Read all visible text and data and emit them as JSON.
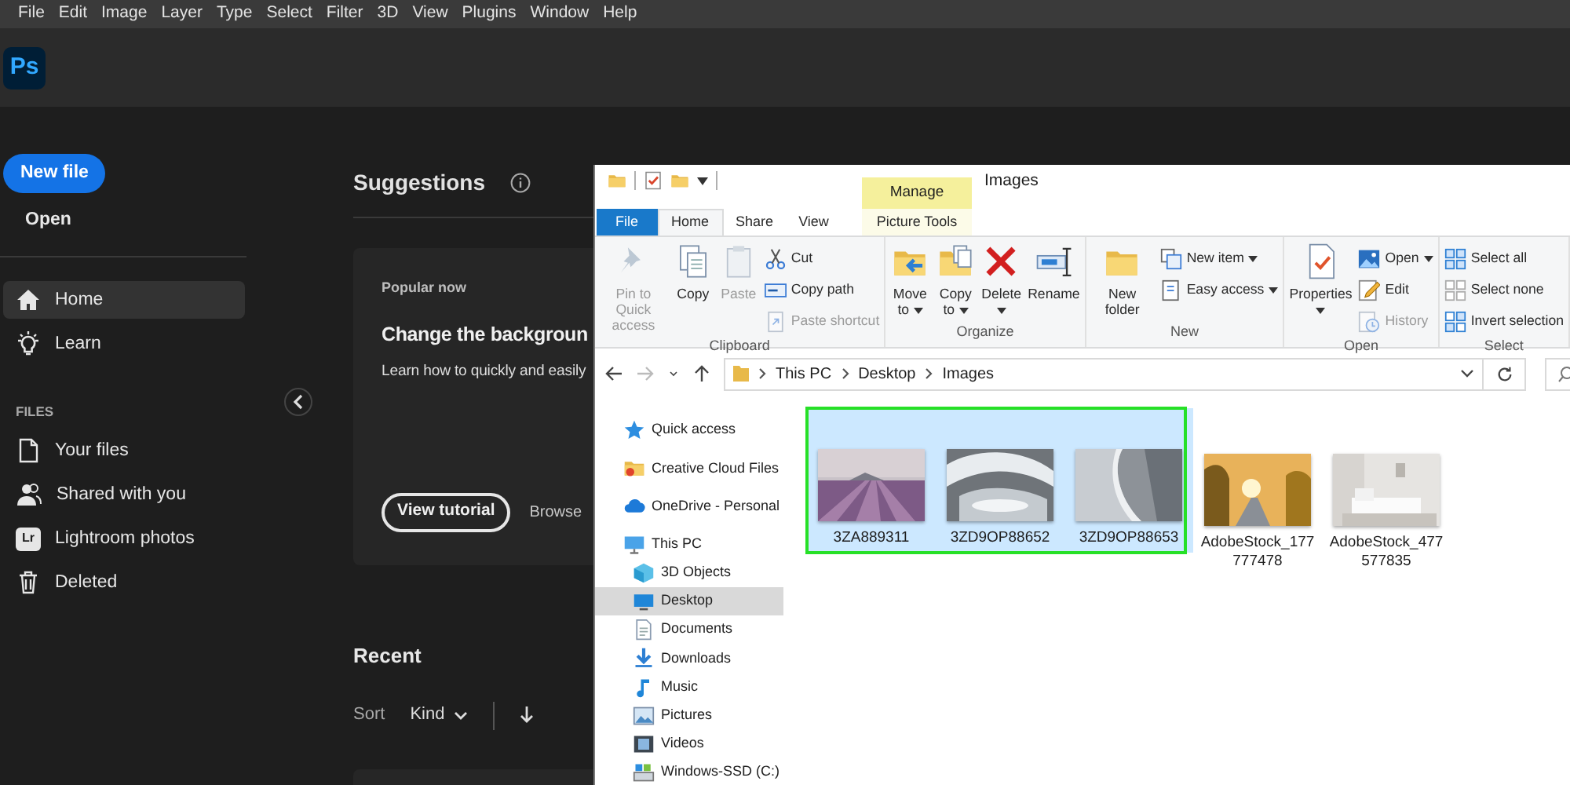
{
  "menu_bar": [
    "File",
    "Edit",
    "Image",
    "Layer",
    "Type",
    "Select",
    "Filter",
    "3D",
    "View",
    "Plugins",
    "Window",
    "Help"
  ],
  "app": {
    "logo": "Ps"
  },
  "sidebar": {
    "new_file": "New file",
    "open": "Open",
    "nav": [
      {
        "label": "Home",
        "selected": true
      },
      {
        "label": "Learn",
        "selected": false
      }
    ],
    "files_heading": "FILES",
    "files": [
      {
        "label": "Your files"
      },
      {
        "label": "Shared with you"
      },
      {
        "label": "Lightroom photos",
        "badge": "Lr"
      },
      {
        "label": "Deleted"
      }
    ]
  },
  "suggestions": {
    "title": "Suggestions",
    "card": {
      "eyebrow": "Popular now",
      "title": "Change the backgroun",
      "description": "Learn how to quickly and easily",
      "button": "View tutorial",
      "link": "Browse"
    }
  },
  "recent": {
    "title": "Recent",
    "sort_label": "Sort",
    "sort_value": "Kind"
  },
  "explorer": {
    "context_tab": "Manage",
    "title": "Images",
    "tabs": [
      {
        "label": "File",
        "kind": "file",
        "selected": false
      },
      {
        "label": "Home",
        "kind": "tab",
        "selected": true
      },
      {
        "label": "Share",
        "kind": "tab",
        "selected": false
      },
      {
        "label": "View",
        "kind": "tab",
        "selected": false
      },
      {
        "label": "Picture Tools",
        "kind": "context",
        "selected": false
      }
    ],
    "ribbon": [
      {
        "label": "Clipboard",
        "commands": [
          {
            "label": "Pin to Quick access",
            "kind": "large",
            "disabled": true,
            "dropdown": false
          },
          {
            "label": "Copy",
            "kind": "large",
            "disabled": false,
            "dropdown": false
          },
          {
            "label": "Paste",
            "kind": "large",
            "disabled": true,
            "dropdown": false
          },
          {
            "label": "Cut",
            "kind": "small",
            "disabled": false,
            "dropdown": false
          },
          {
            "label": "Copy path",
            "kind": "small",
            "disabled": false,
            "dropdown": false
          },
          {
            "label": "Paste shortcut",
            "kind": "small",
            "disabled": true,
            "dropdown": false
          }
        ]
      },
      {
        "label": "Organize",
        "commands": [
          {
            "label": "Move to",
            "kind": "large",
            "disabled": false,
            "dropdown": true
          },
          {
            "label": "Copy to",
            "kind": "large",
            "disabled": false,
            "dropdown": true
          },
          {
            "label": "Delete",
            "kind": "large",
            "disabled": false,
            "dropdown": true
          },
          {
            "label": "Rename",
            "kind": "large",
            "disabled": false,
            "dropdown": false
          }
        ]
      },
      {
        "label": "New",
        "commands": [
          {
            "label": "New folder",
            "kind": "large",
            "disabled": false,
            "dropdown": false
          },
          {
            "label": "New item",
            "kind": "small",
            "disabled": false,
            "dropdown": true
          },
          {
            "label": "Easy access",
            "kind": "small",
            "disabled": false,
            "dropdown": true
          }
        ]
      },
      {
        "label": "Open",
        "commands": [
          {
            "label": "Properties",
            "kind": "large",
            "disabled": false,
            "dropdown": true
          },
          {
            "label": "Open",
            "kind": "small",
            "disabled": false,
            "dropdown": true
          },
          {
            "label": "Edit",
            "kind": "small",
            "disabled": false,
            "dropdown": false
          },
          {
            "label": "History",
            "kind": "small",
            "disabled": true,
            "dropdown": false
          }
        ]
      },
      {
        "label": "Select",
        "commands": [
          {
            "label": "Select all",
            "kind": "small",
            "disabled": false,
            "dropdown": false
          },
          {
            "label": "Select none",
            "kind": "small",
            "disabled": false,
            "dropdown": false
          },
          {
            "label": "Invert selection",
            "kind": "small",
            "disabled": false,
            "dropdown": false
          }
        ]
      }
    ],
    "address": [
      "This PC",
      "Desktop",
      "Images"
    ],
    "nav_tree": [
      {
        "label": "Quick access",
        "selected": false
      },
      {
        "label": "Creative Cloud Files",
        "selected": false
      },
      {
        "label": "OneDrive - Personal",
        "selected": false
      },
      {
        "label": "This PC",
        "selected": false,
        "children": [
          {
            "label": "3D Objects",
            "selected": false
          },
          {
            "label": "Desktop",
            "selected": true
          },
          {
            "label": "Documents",
            "selected": false
          },
          {
            "label": "Downloads",
            "selected": false
          },
          {
            "label": "Music",
            "selected": false
          },
          {
            "label": "Pictures",
            "selected": false
          },
          {
            "label": "Videos",
            "selected": false
          },
          {
            "label": "Windows-SSD (C:)",
            "selected": false
          }
        ]
      }
    ],
    "files": [
      {
        "name": "3ZA889311",
        "selected": true
      },
      {
        "name": "3ZD9OP88652",
        "selected": true
      },
      {
        "name": "3ZD9OP88653",
        "selected": true
      },
      {
        "name": "AdobeStock_177777478",
        "selected": false
      },
      {
        "name": "AdobeStock_477577835",
        "selected": false
      }
    ]
  }
}
